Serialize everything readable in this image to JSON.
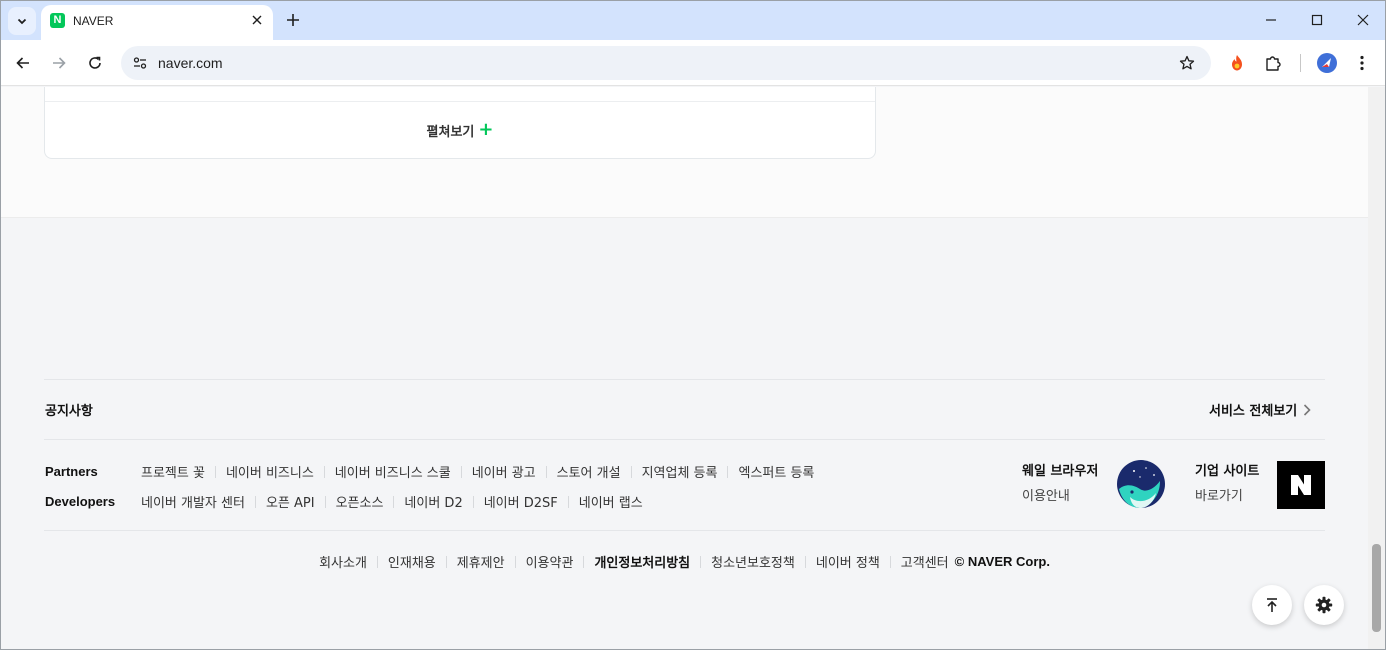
{
  "browser": {
    "tab_title": "NAVER",
    "favicon_letter": "N",
    "url": "naver.com",
    "accent": "#03c75a"
  },
  "page": {
    "expand_label": "펼쳐보기",
    "expand_icon": "+",
    "notice_label": "공지사항",
    "all_services_label": "서비스 전체보기",
    "partners": {
      "label": "Partners",
      "links": [
        "프로젝트 꽃",
        "네이버 비즈니스",
        "네이버 비즈니스 스쿨",
        "네이버 광고",
        "스토어 개설",
        "지역업체 등록",
        "엑스퍼트 등록"
      ]
    },
    "developers": {
      "label": "Developers",
      "links": [
        "네이버 개발자 센터",
        "오픈 API",
        "오픈소스",
        "네이버 D2",
        "네이버 D2SF",
        "네이버 랩스"
      ]
    },
    "whale": {
      "title": "웨일 브라우저",
      "sub": "이용안내"
    },
    "corp": {
      "title": "기업 사이트",
      "sub": "바로가기"
    },
    "bottom_links": [
      "회사소개",
      "인재채용",
      "제휴제안",
      "이용약관",
      "개인정보처리방침",
      "청소년보호정책",
      "네이버 정책",
      "고객센터"
    ],
    "copyright": "© NAVER Corp."
  }
}
